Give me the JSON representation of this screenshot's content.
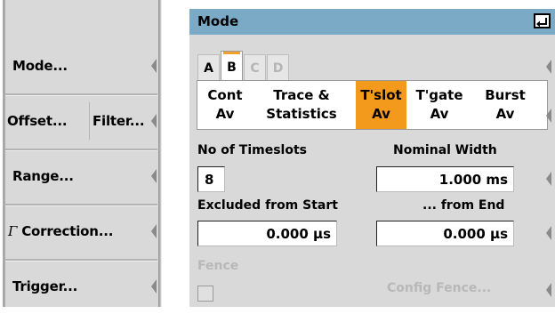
{
  "softkeys": {
    "mode": "Mode...",
    "offset": "Offset...",
    "filter": "Filter...",
    "range": "Range...",
    "correction_symbol": "Γ",
    "correction": "Correction...",
    "trigger": "Trigger..."
  },
  "dialog": {
    "title": "Mode",
    "tabs": [
      {
        "label": "A",
        "state": "enabled"
      },
      {
        "label": "B",
        "state": "selected"
      },
      {
        "label": "C",
        "state": "disabled"
      },
      {
        "label": "D",
        "state": "disabled"
      }
    ],
    "modes": [
      {
        "line1": "Cont",
        "line2": "Av"
      },
      {
        "line1": "Trace &",
        "line2": "Statistics"
      },
      {
        "line1": "T'slot",
        "line2": "Av",
        "selected": true
      },
      {
        "line1": "T'gate",
        "line2": "Av"
      },
      {
        "line1": "Burst",
        "line2": "Av"
      }
    ],
    "timeslots": {
      "label": "No of Timeslots",
      "value": "8"
    },
    "nominal_width": {
      "label": "Nominal Width",
      "value": "1.000 ms"
    },
    "excluded_start": {
      "label": "Excluded from Start",
      "value": "0.000 µs"
    },
    "excluded_end": {
      "label": "... from End",
      "value": "0.000 µs"
    },
    "fence": {
      "label": "Fence",
      "checked": false
    },
    "config_fence": "Config Fence..."
  },
  "colors": {
    "titlebar": "#7aaac6",
    "selected_mode": "#f39a1c",
    "panel": "#d9d9d9",
    "disabled_text": "#b8b8b8"
  },
  "icons": [
    "enter-key-icon",
    "softkey-arrow-icon"
  ]
}
